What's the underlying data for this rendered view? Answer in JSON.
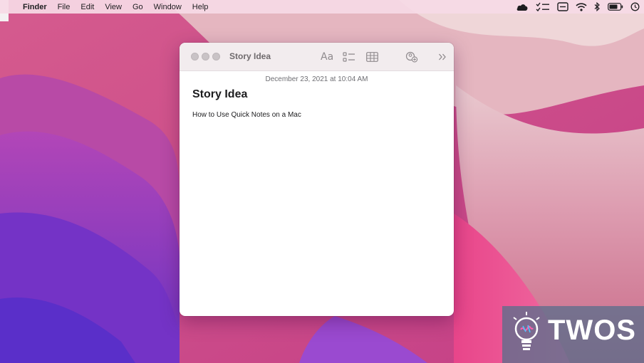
{
  "menubar": {
    "app_name": "Finder",
    "items": [
      "File",
      "Edit",
      "View",
      "Go",
      "Window",
      "Help"
    ],
    "status_icons": [
      "icloud-icon",
      "checklist-icon",
      "screen-share-icon",
      "wifi-icon",
      "bluetooth-icon",
      "battery-icon",
      "time-machine-icon"
    ]
  },
  "window": {
    "title": "Story Idea",
    "toolbar": {
      "format_label": "Aa",
      "icons": [
        "checklist-icon",
        "table-icon",
        "collaborate-icon",
        "more-icon"
      ]
    },
    "note": {
      "timestamp": "December 23, 2021 at 10:04 AM",
      "title": "Story Idea",
      "body": "How to Use Quick Notes on a Mac"
    }
  },
  "watermark": {
    "text": "TWOS"
  },
  "colors": {
    "menubar_bg": "#f6dae6",
    "window_bg": "#ffffff",
    "titlebar_bg": "#f2ecee",
    "watermark_bg": "#5c6e8c"
  }
}
